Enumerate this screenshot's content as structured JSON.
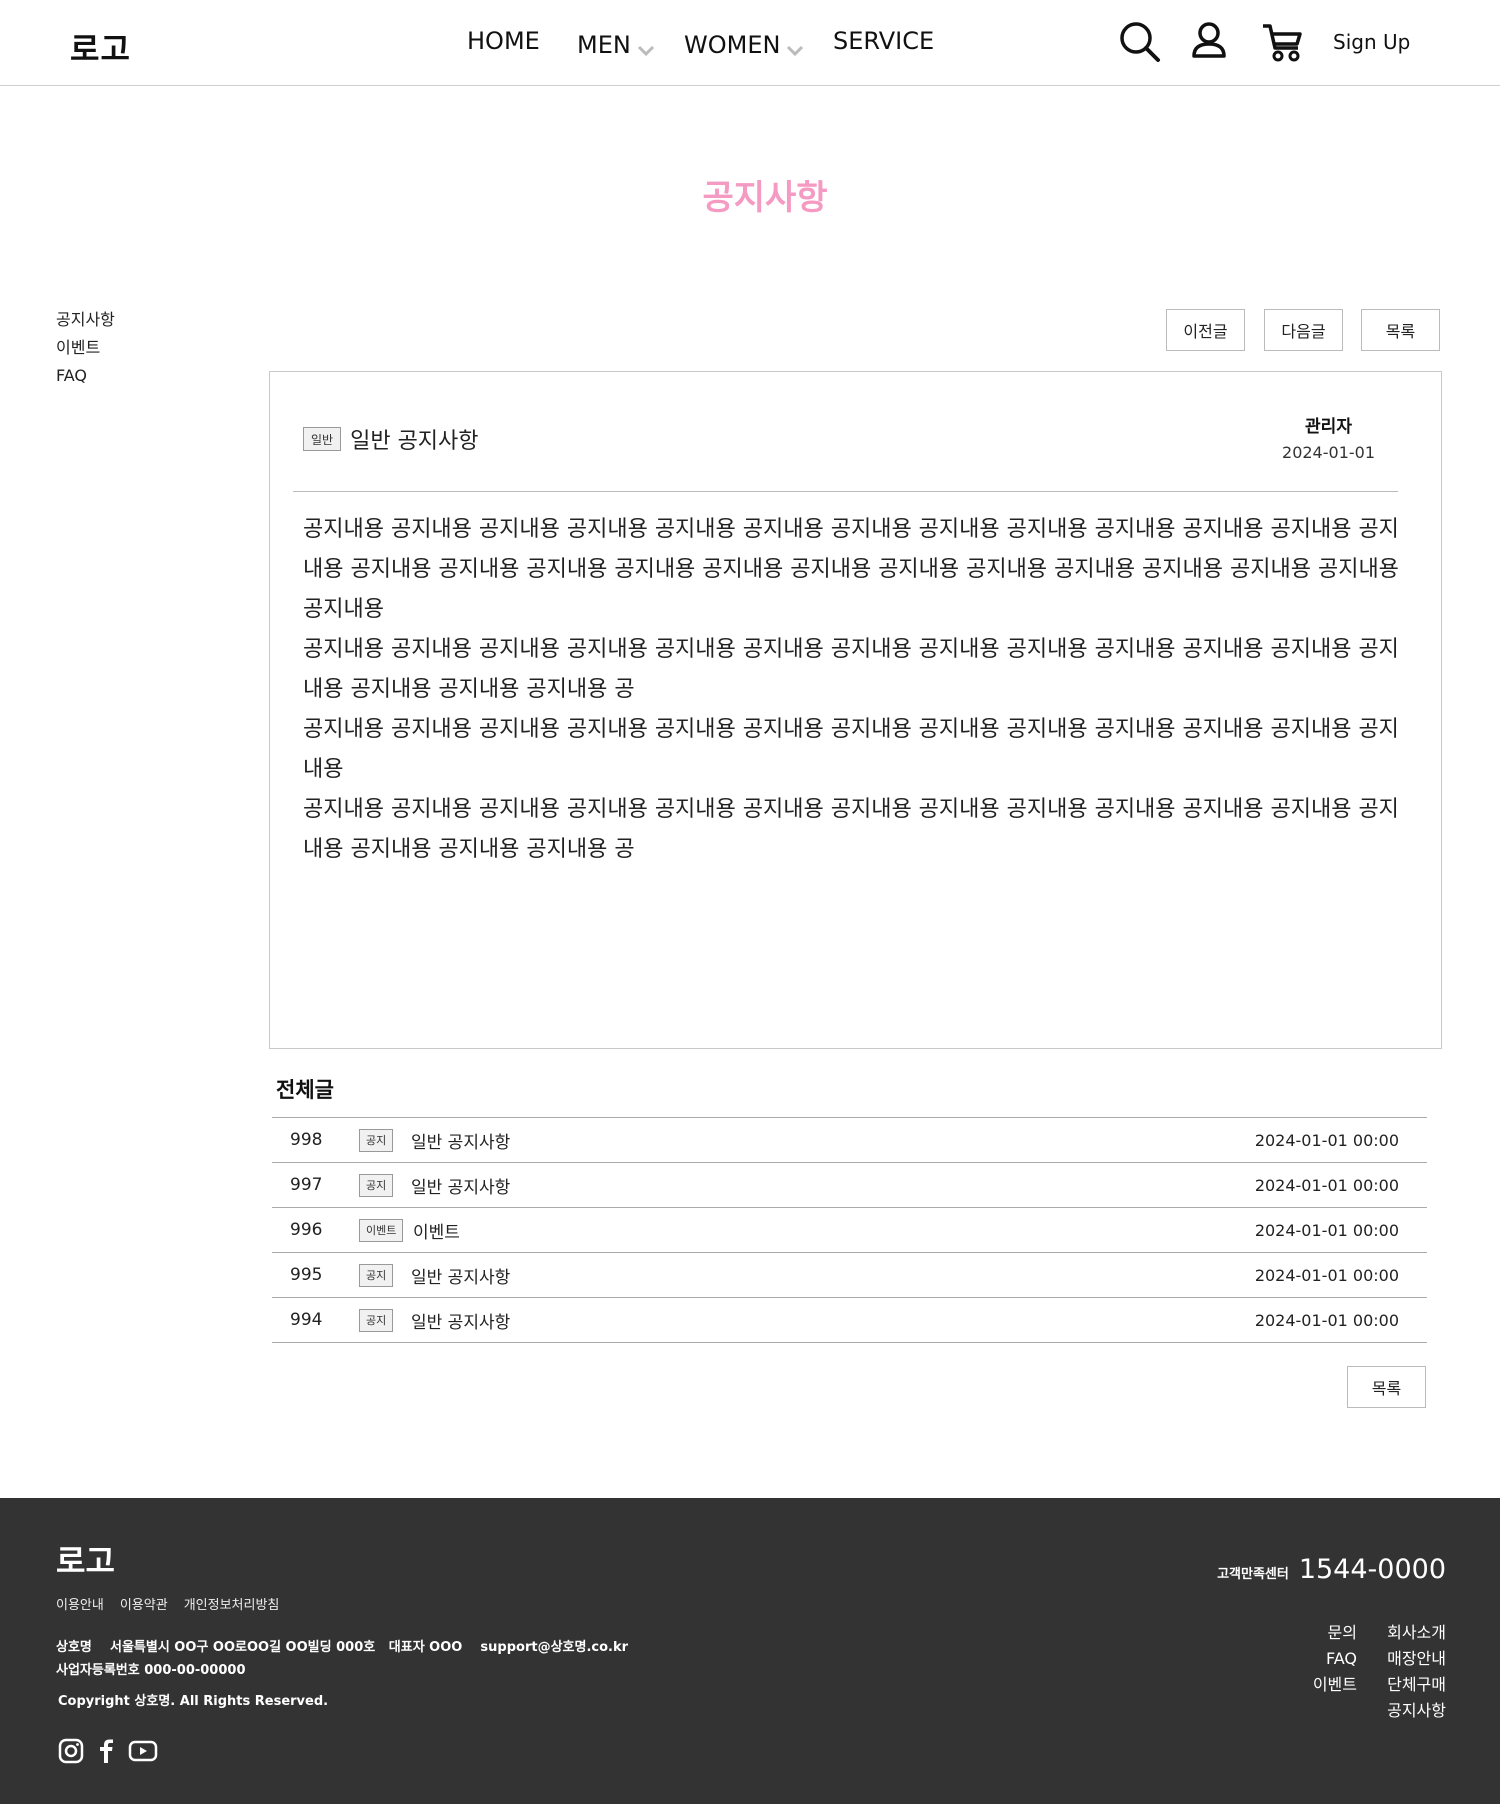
{
  "header": {
    "logo": "로고",
    "nav": [
      "HOME",
      "MEN",
      "WOMEN",
      "SERVICE"
    ],
    "signup": "Sign Up",
    "icons": [
      "search-icon",
      "user-icon",
      "cart-icon",
      "chevron-down-icon"
    ]
  },
  "page_title": "공지사항",
  "sidebar": {
    "items": [
      "공지사항",
      "이벤트",
      "FAQ"
    ]
  },
  "actions": {
    "prev": "이전글",
    "next": "다음글",
    "list": "목록"
  },
  "article": {
    "tag": "일반",
    "title": "일반 공지사항",
    "author": "관리자",
    "date": "2024-01-01",
    "paragraphs": [
      "공지내용 공지내용 공지내용 공지내용 공지내용 공지내용 공지내용 공지내용 공지내용 공지내용 공지내용 공지내용 공지내용 공지내용 공지내용 공지내용 공지내용 공지내용 공지내용 공지내용 공지내용 공지내용 공지내용 공지내용 공지내용 공지내용",
      "공지내용 공지내용 공지내용 공지내용 공지내용 공지내용 공지내용 공지내용 공지내용 공지내용 공지내용 공지내용 공지내용 공지내용 공지내용 공지내용 공",
      "공지내용 공지내용 공지내용 공지내용 공지내용 공지내용 공지내용 공지내용 공지내용 공지내용 공지내용 공지내용 공지내용",
      "공지내용 공지내용 공지내용 공지내용 공지내용 공지내용 공지내용 공지내용 공지내용 공지내용 공지내용 공지내용 공지내용 공지내용 공지내용 공지내용 공"
    ]
  },
  "list": {
    "heading": "전체글",
    "rows": [
      {
        "num": "998",
        "tag": "공지",
        "title": "일반 공지사항",
        "date": "2024-01-01 00:00"
      },
      {
        "num": "997",
        "tag": "공지",
        "title": "일반 공지사항",
        "date": "2024-01-01 00:00"
      },
      {
        "num": "996",
        "tag": "이벤트",
        "title": "이벤트",
        "date": "2024-01-01 00:00"
      },
      {
        "num": "995",
        "tag": "공지",
        "title": "일반 공지사항",
        "date": "2024-01-01 00:00"
      },
      {
        "num": "994",
        "tag": "공지",
        "title": "일반 공지사항",
        "date": "2024-01-01 00:00"
      }
    ],
    "list_button": "목록"
  },
  "footer": {
    "logo": "로고",
    "links": [
      "이용안내",
      "이용약관",
      "개인정보처리방침"
    ],
    "info_line1": "상호명    서울특별시 OO구 OO로OO길 OO빌딩 000호   대표자 OOO    support@상호명.co.kr",
    "info_line2": "사업자등록번호 000-00-00000",
    "copyright": "Copyright 상호명. All Rights Reserved.",
    "cs_label": "고객만족센터",
    "cs_tel": "1544-0000",
    "menu_col1": [
      "문의",
      "FAQ",
      "이벤트"
    ],
    "menu_col2": [
      "회사소개",
      "매장안내",
      "단체구매",
      "공지사항"
    ],
    "social": [
      "instagram-icon",
      "facebook-icon",
      "youtube-icon"
    ]
  },
  "colors": {
    "title_pink": "#f59ac2",
    "footer_bg": "#333333"
  }
}
